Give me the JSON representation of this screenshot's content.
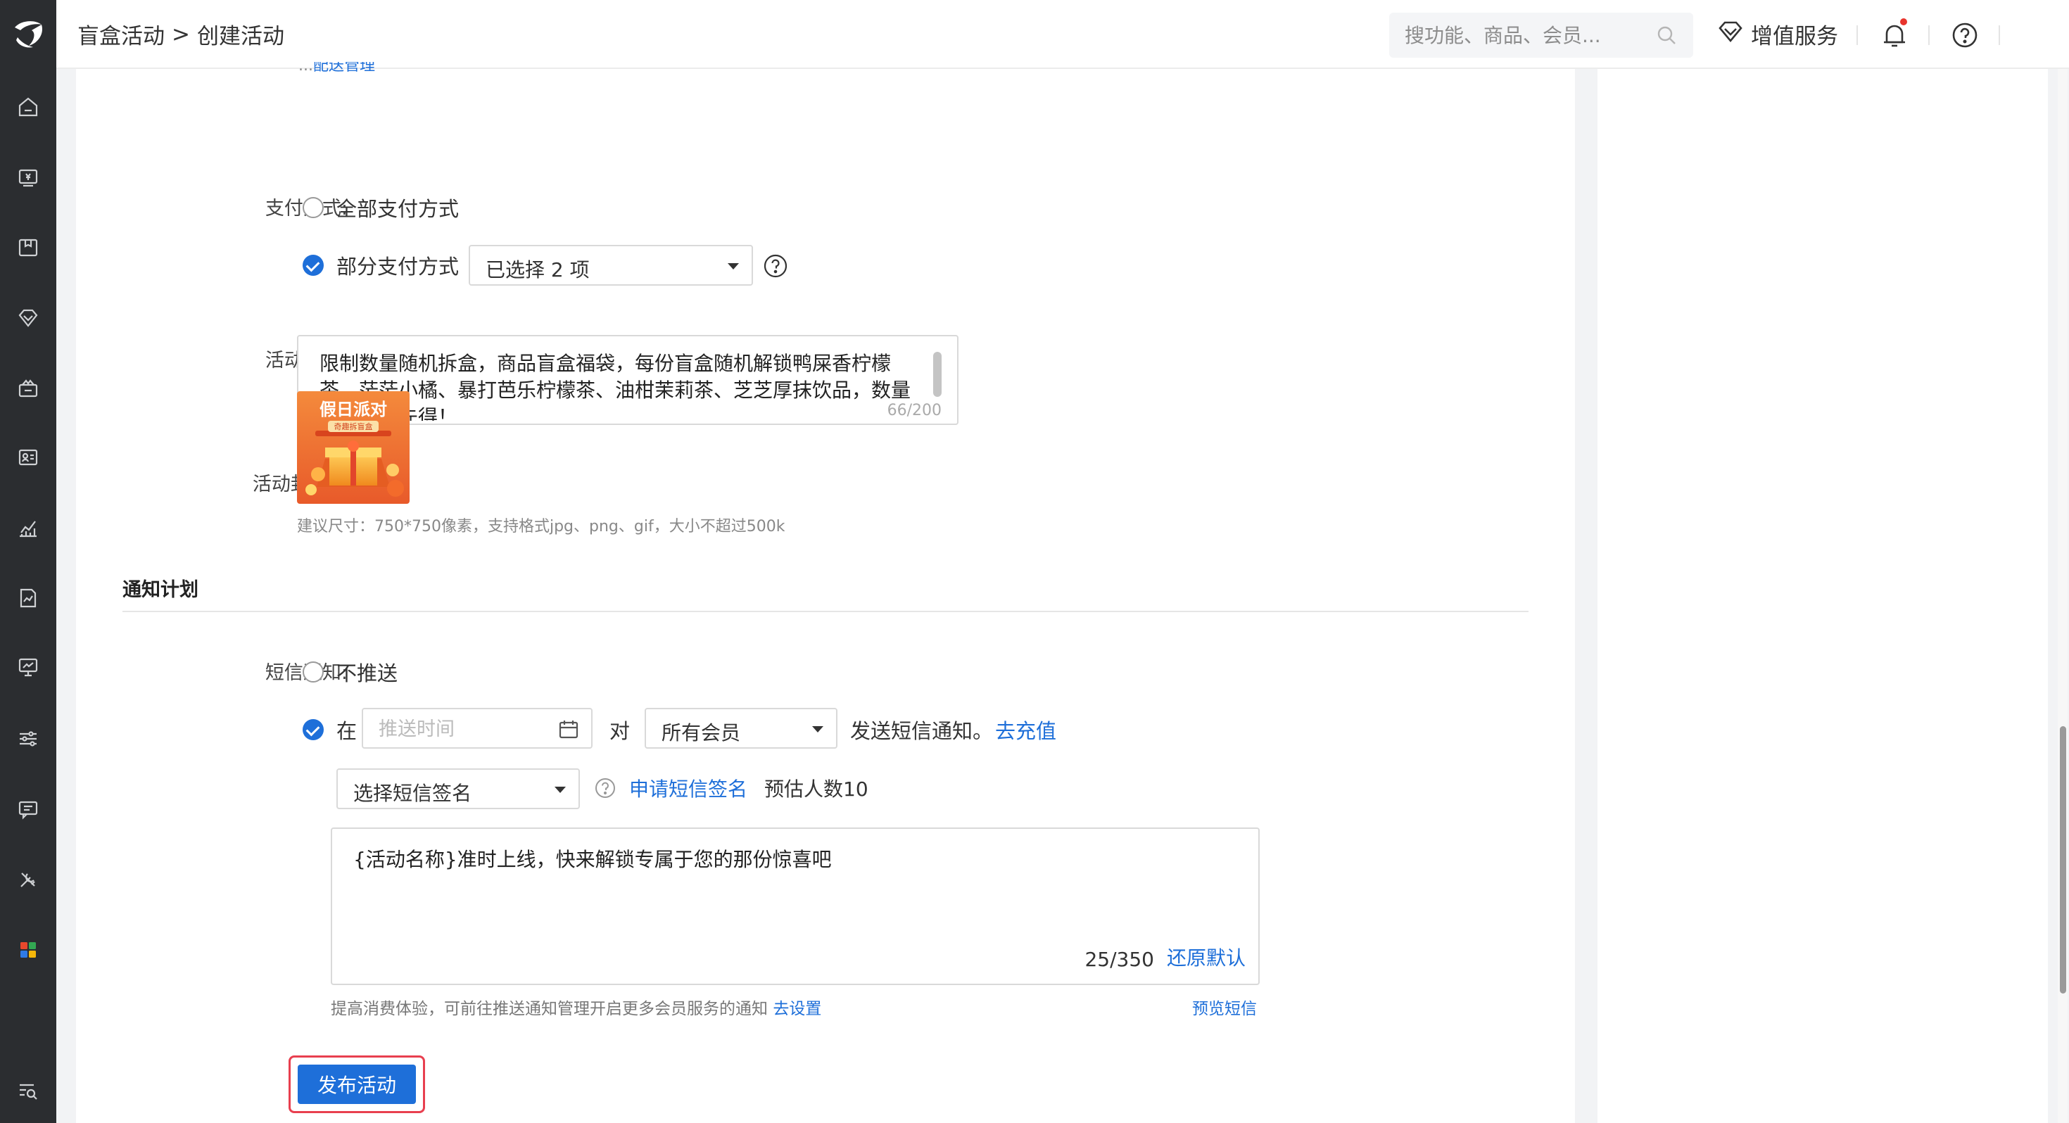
{
  "header": {
    "breadcrumb_parent": "盲盒活动",
    "breadcrumb_sep": ">",
    "breadcrumb_current": "创建活动",
    "search_placeholder": "搜功能、商品、会员...",
    "value_added_label": "增值服务"
  },
  "nav_icons": [
    "home-icon",
    "cashier-icon",
    "goods-icon",
    "member-icon",
    "marketing-icon",
    "customer-card-icon",
    "analytics-icon",
    "report-icon",
    "monitor-icon",
    "settings-sliders-icon",
    "message-icon",
    "tools-icon",
    "apps-icon",
    "search-list-icon"
  ],
  "form": {
    "cut_text_prefix": "...",
    "cut_text_link": "配送管理",
    "payment": {
      "label": "支付方式:",
      "option_all": "全部支付方式",
      "option_partial": "部分支付方式",
      "partial_checked": true,
      "select_value": "已选择 2 项"
    },
    "description": {
      "label": "活动说明:",
      "text": "限制数量随机拆盒，商品盲盒福袋，每份盲盒随机解锁鸭屎香柠檬茶、茫茫小橘、暴打芭乐柠檬茶、油柑茉莉茶、芝芝厚抹饮品，数量有限先到先得！",
      "count": "66/200"
    },
    "cover": {
      "label": "活动封面:",
      "title_text": "假日派对",
      "sub_text": "奇趣拆盲盒",
      "hint": "建议尺寸：750*750像素，支持格式jpg、png、gif，大小不超过500k"
    },
    "notify_section_title": "通知计划",
    "sms": {
      "label": "短信通知:",
      "option_no_push": "不推送",
      "option_at": "在",
      "time_placeholder": "推送时间",
      "to_text": "对",
      "audience_value": "所有会员",
      "send_text": "发送短信通知。",
      "recharge_link": "去充值",
      "signature_placeholder": "选择短信签名",
      "apply_signature_link": "申请短信签名",
      "estimate_text": "预估人数10",
      "content": "{活动名称}准时上线，快来解锁专属于您的那份惊喜吧",
      "count": "25/350",
      "reset_link": "还原默认",
      "tip_text": "提高消费体验，可前往推送通知管理开启更多会员服务的通知",
      "tip_link": "去设置",
      "preview_link": "预览短信"
    },
    "publish_button": "发布活动"
  },
  "colors": {
    "accent": "#1e6fd9",
    "nav_bg": "#2b2d30",
    "highlight_border": "#e83f4f",
    "notify_dot": "#e8342d"
  }
}
